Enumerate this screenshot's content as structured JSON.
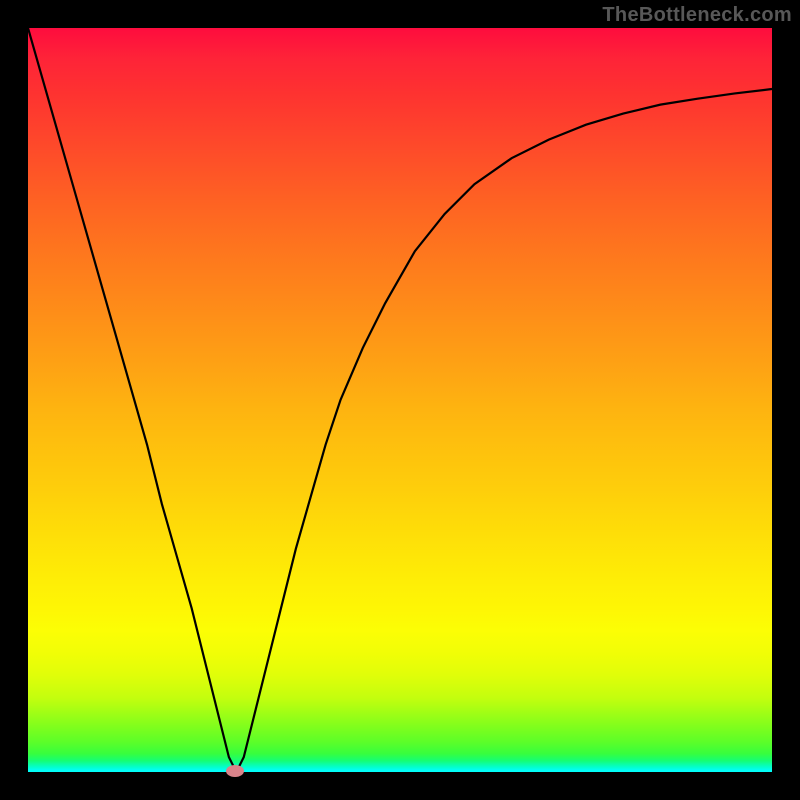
{
  "watermark": "TheBottleneck.com",
  "chart_data": {
    "type": "line",
    "title": "",
    "xlabel": "",
    "ylabel": "",
    "x_range": [
      0,
      100
    ],
    "y_range": [
      0,
      100
    ],
    "series": [
      {
        "name": "bottleneck-curve",
        "x": [
          0,
          2,
          4,
          6,
          8,
          10,
          12,
          14,
          16,
          18,
          20,
          22,
          24,
          26,
          27,
          28,
          29,
          30,
          32,
          34,
          36,
          38,
          40,
          42,
          45,
          48,
          52,
          56,
          60,
          65,
          70,
          75,
          80,
          85,
          90,
          95,
          100
        ],
        "y": [
          100,
          93,
          86,
          79,
          72,
          65,
          58,
          51,
          44,
          36,
          29,
          22,
          14,
          6,
          2,
          0,
          2,
          6,
          14,
          22,
          30,
          37,
          44,
          50,
          57,
          63,
          70,
          75,
          79,
          82.5,
          85,
          87,
          88.5,
          89.7,
          90.5,
          91.2,
          91.8
        ]
      }
    ],
    "marker": {
      "x_pct": 27.8,
      "y_pct": 99.9,
      "color": "#d9838a"
    },
    "gradient_stops": [
      {
        "pct": 0,
        "color": "#fe0c3e"
      },
      {
        "pct": 50,
        "color": "#feb310"
      },
      {
        "pct": 80,
        "color": "#fcfe05"
      },
      {
        "pct": 100,
        "color": "#01fefc"
      }
    ]
  }
}
